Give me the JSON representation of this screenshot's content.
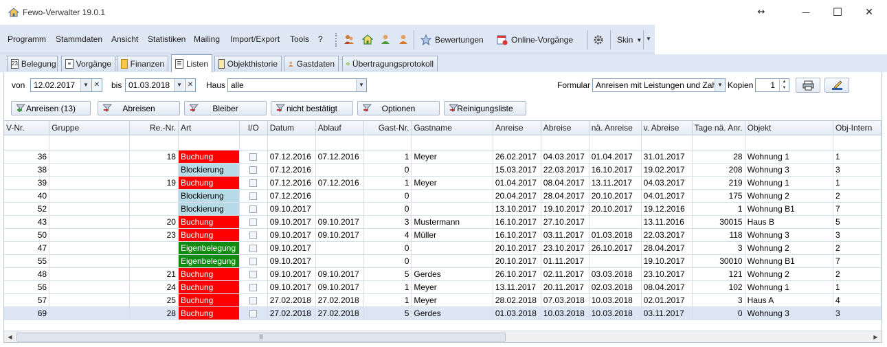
{
  "window": {
    "title": "Fewo-Verwalter 19.0.1",
    "resize_glyph": "↔",
    "min_glyph": "—",
    "max_glyph": "☐",
    "close_glyph": "✕"
  },
  "menu": {
    "items": [
      "Programm",
      "Stammdaten",
      "Ansicht",
      "Statistiken",
      "Mailing",
      "Import/Export",
      "Tools",
      "?"
    ]
  },
  "toolbar": {
    "bewertungen": "Bewertungen",
    "online_vorgaenge": "Online-Vorgänge",
    "skin": "Skin"
  },
  "tabs": [
    {
      "label": "Belegung",
      "icon": "calendar-icon"
    },
    {
      "label": "Vorgänge",
      "icon": "document-icon"
    },
    {
      "label": "Finanzen",
      "icon": "coins-icon"
    },
    {
      "label": "Listen",
      "icon": "list-icon",
      "active": true
    },
    {
      "label": "Objekthistorie",
      "icon": "clipboard-icon"
    },
    {
      "label": "Gastdaten",
      "icon": "person-icon"
    },
    {
      "label": "Übertragungsprotokoll",
      "icon": "check-icon"
    }
  ],
  "filter": {
    "von_label": "von",
    "von_value": "12.02.2017",
    "bis_label": "bis",
    "bis_value": "01.03.2018",
    "haus_label": "Haus",
    "haus_value": "alle",
    "formular_label": "Formular",
    "formular_value": "Anreisen mit Leistungen und Zah...",
    "kopien_label": "Kopien",
    "kopien_value": "1"
  },
  "filter_buttons": [
    "Anreisen (13)",
    "Abreisen",
    "Bleiber",
    "nicht bestätigt",
    "Optionen",
    "Reinigungsliste"
  ],
  "columns": [
    "V-Nr.",
    "Gruppe",
    "Re.-Nr.",
    "Art",
    "I/O",
    "Datum",
    "Ablauf",
    "Gast-Nr.",
    "Gastname",
    "Anreise",
    "Abreise",
    "nä. Anreise",
    "v. Abreise",
    "Tage nä. Anr.",
    "Objekt",
    "Obj-Intern"
  ],
  "rows": [
    [
      "36",
      "",
      "18",
      "Buchung",
      "",
      "07.12.2016",
      "07.12.2016",
      "1",
      "Meyer",
      "26.02.2017",
      "04.03.2017",
      "01.04.2017",
      "31.01.2017",
      "28",
      "Wohnung 1",
      "1"
    ],
    [
      "38",
      "",
      "",
      "Blockierung",
      "",
      "07.12.2016",
      "",
      "0",
      "",
      "15.03.2017",
      "22.03.2017",
      "16.10.2017",
      "19.02.2017",
      "208",
      "Wohnung 3",
      "3"
    ],
    [
      "39",
      "",
      "19",
      "Buchung",
      "",
      "07.12.2016",
      "07.12.2016",
      "1",
      "Meyer",
      "01.04.2017",
      "08.04.2017",
      "13.11.2017",
      "04.03.2017",
      "219",
      "Wohnung 1",
      "1"
    ],
    [
      "40",
      "",
      "",
      "Blockierung",
      "",
      "07.12.2016",
      "",
      "0",
      "",
      "20.04.2017",
      "28.04.2017",
      "20.10.2017",
      "04.01.2017",
      "175",
      "Wohnung 2",
      "2"
    ],
    [
      "52",
      "",
      "",
      "Blockierung",
      "",
      "09.10.2017",
      "",
      "0",
      "",
      "13.10.2017",
      "19.10.2017",
      "20.10.2017",
      "19.12.2016",
      "1",
      "Wohnung B1",
      "7"
    ],
    [
      "43",
      "",
      "20",
      "Buchung",
      "",
      "09.10.2017",
      "09.10.2017",
      "3",
      "Mustermann",
      "16.10.2017",
      "27.10.2017",
      "",
      "13.11.2016",
      "30015",
      "Haus B",
      "5"
    ],
    [
      "50",
      "",
      "23",
      "Buchung",
      "",
      "09.10.2017",
      "09.10.2017",
      "4",
      "Müller",
      "16.10.2017",
      "03.11.2017",
      "01.03.2018",
      "22.03.2017",
      "118",
      "Wohnung 3",
      "3"
    ],
    [
      "47",
      "",
      "",
      "Eigenbelegung",
      "",
      "09.10.2017",
      "",
      "0",
      "",
      "20.10.2017",
      "23.10.2017",
      "26.10.2017",
      "28.04.2017",
      "3",
      "Wohnung 2",
      "2"
    ],
    [
      "55",
      "",
      "",
      "Eigenbelegung",
      "",
      "09.10.2017",
      "",
      "0",
      "",
      "20.10.2017",
      "01.11.2017",
      "",
      "19.10.2017",
      "30010",
      "Wohnung B1",
      "7"
    ],
    [
      "48",
      "",
      "21",
      "Buchung",
      "",
      "09.10.2017",
      "09.10.2017",
      "5",
      "Gerdes",
      "26.10.2017",
      "02.11.2017",
      "03.03.2018",
      "23.10.2017",
      "121",
      "Wohnung 2",
      "2"
    ],
    [
      "56",
      "",
      "24",
      "Buchung",
      "",
      "09.10.2017",
      "09.10.2017",
      "1",
      "Meyer",
      "13.11.2017",
      "20.11.2017",
      "02.03.2018",
      "08.04.2017",
      "102",
      "Wohnung 1",
      "1"
    ],
    [
      "57",
      "",
      "25",
      "Buchung",
      "",
      "27.02.2018",
      "27.02.2018",
      "1",
      "Meyer",
      "28.02.2018",
      "07.03.2018",
      "10.03.2018",
      "02.01.2017",
      "3",
      "Haus A",
      "4"
    ],
    [
      "69",
      "",
      "28",
      "Buchung",
      "",
      "27.02.2018",
      "27.02.2018",
      "5",
      "Gerdes",
      "01.03.2018",
      "10.03.2018",
      "10.03.2018",
      "03.11.2017",
      "0",
      "Wohnung 3",
      "3"
    ]
  ],
  "colors": {
    "buchung": "#ff0000",
    "blockierung": "#b8dbe8",
    "eigenbelegung": "#118a11",
    "band": "#dee7f3"
  }
}
